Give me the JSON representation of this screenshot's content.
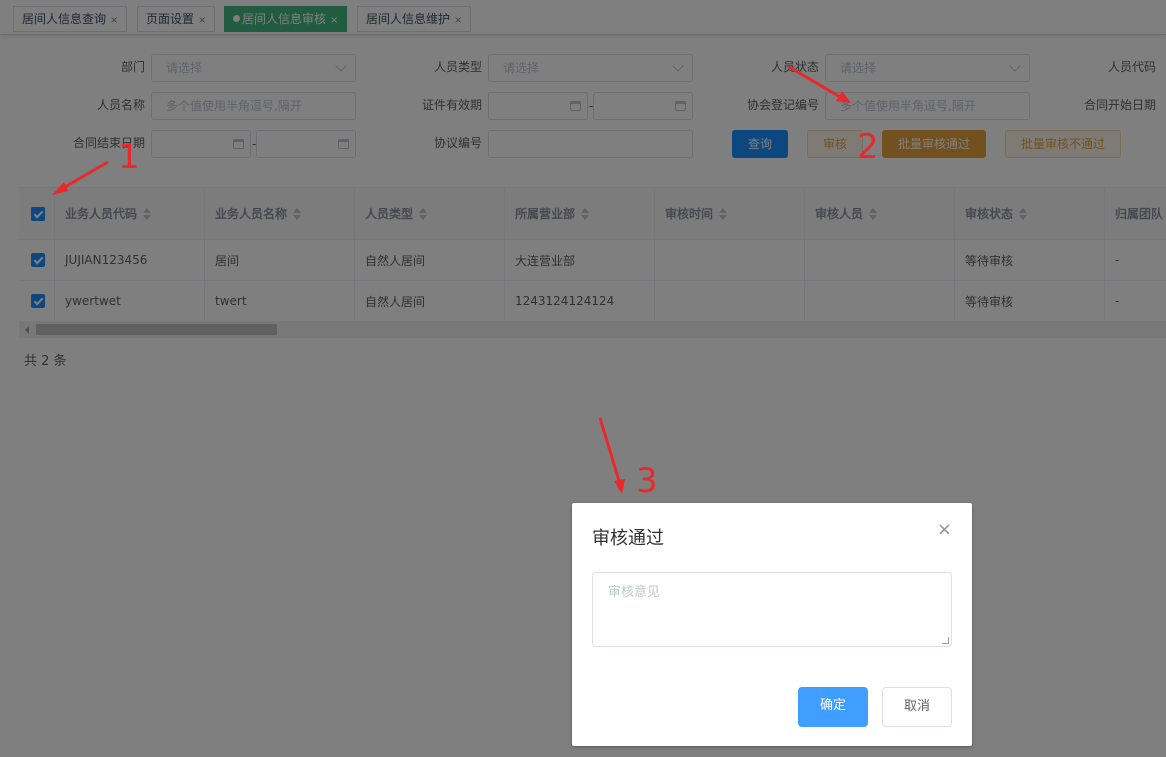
{
  "tabs": [
    {
      "label": "居间人信息查询",
      "close": "×"
    },
    {
      "label": "页面设置",
      "close": "×"
    },
    {
      "label": "居间人信息审核",
      "close": "×"
    },
    {
      "label": "居间人信息维护",
      "close": "×"
    }
  ],
  "filters": {
    "department": {
      "label": "部门",
      "placeholder": "请选择"
    },
    "person_type": {
      "label": "人员类型",
      "placeholder": "请选择"
    },
    "person_status": {
      "label": "人员状态",
      "placeholder": "请选择"
    },
    "person_code": {
      "label": "人员代码"
    },
    "person_name": {
      "label": "人员名称",
      "placeholder": "多个值使用半角逗号,隔开"
    },
    "cert_validity": {
      "label": "证件有效期",
      "separator": "-"
    },
    "assoc_reg_no": {
      "label": "协会登记编号",
      "placeholder": "多个值使用半角逗号,隔开"
    },
    "contract_start": {
      "label": "合同开始日期"
    },
    "contract_end": {
      "label": "合同结束日期",
      "separator": "-"
    },
    "agreement_no": {
      "label": "协议编号"
    }
  },
  "buttons": {
    "query": "查询",
    "audit": "审核",
    "batch_pass": "批量审核通过",
    "batch_fail": "批量审核不通过"
  },
  "table": {
    "headers": [
      "业务人员代码",
      "业务人员名称",
      "人员类型",
      "所属营业部",
      "审核时间",
      "审核人员",
      "审核状态",
      "归属团队"
    ],
    "rows": [
      [
        "JUJIAN123456",
        "居间",
        "自然人居间",
        "大连营业部",
        "",
        "",
        "等待审核",
        "-"
      ],
      [
        "ywertwet",
        "twert",
        "自然人居间",
        "1243124124124",
        "",
        "",
        "等待审核",
        "-"
      ]
    ]
  },
  "pagination": {
    "total": "共 2 条"
  },
  "dialog": {
    "title": "审核通过",
    "close": "×",
    "placeholder": "审核意见",
    "ok": "确定",
    "cancel": "取消"
  },
  "annotations": [
    "1",
    "2",
    "3"
  ],
  "colors": {
    "accent": "#1890ff",
    "warning": "#e6a23c",
    "active_tab": "#42b983",
    "arrow": "#e8282b"
  }
}
